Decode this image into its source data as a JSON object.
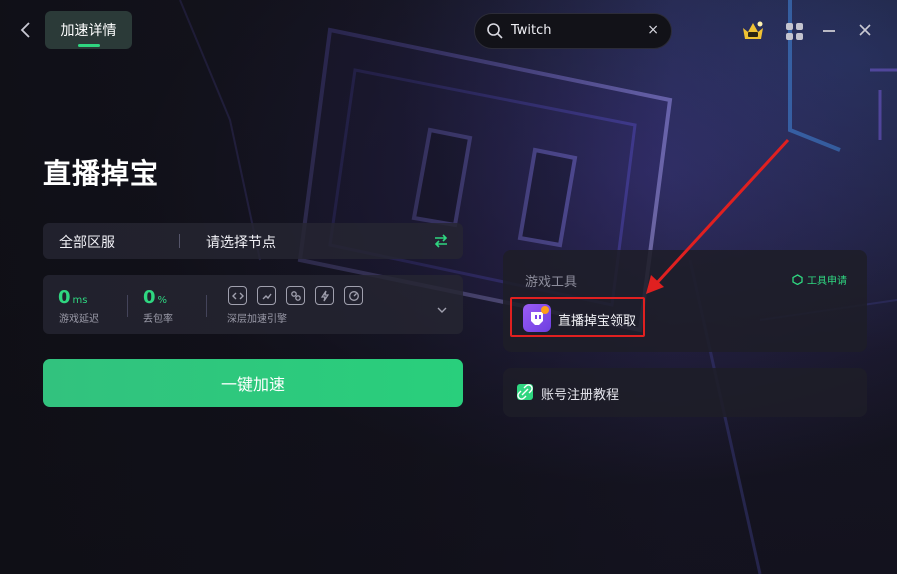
{
  "header": {
    "tab_label": "加速详情",
    "search_value": "Twitch",
    "search_clear": "×"
  },
  "main": {
    "title": "直播掉宝",
    "region_label": "全部区服",
    "node_label": "请选择节点",
    "stats": {
      "latency_value": "0",
      "latency_unit": "ms",
      "latency_label": "游戏延迟",
      "loss_value": "0",
      "loss_unit": "%",
      "loss_label": "丢包率",
      "engine_label": "深层加速引擎"
    },
    "accelerate_label": "一键加速"
  },
  "tools": {
    "title": "游戏工具",
    "apply_label": "工具申请",
    "item_label": "直播掉宝领取"
  },
  "guide": {
    "label": "账号注册教程"
  },
  "colors": {
    "accent_green": "#2fd680",
    "highlight_red": "#e02020",
    "tool_icon_purple": "#8b4ff0"
  }
}
